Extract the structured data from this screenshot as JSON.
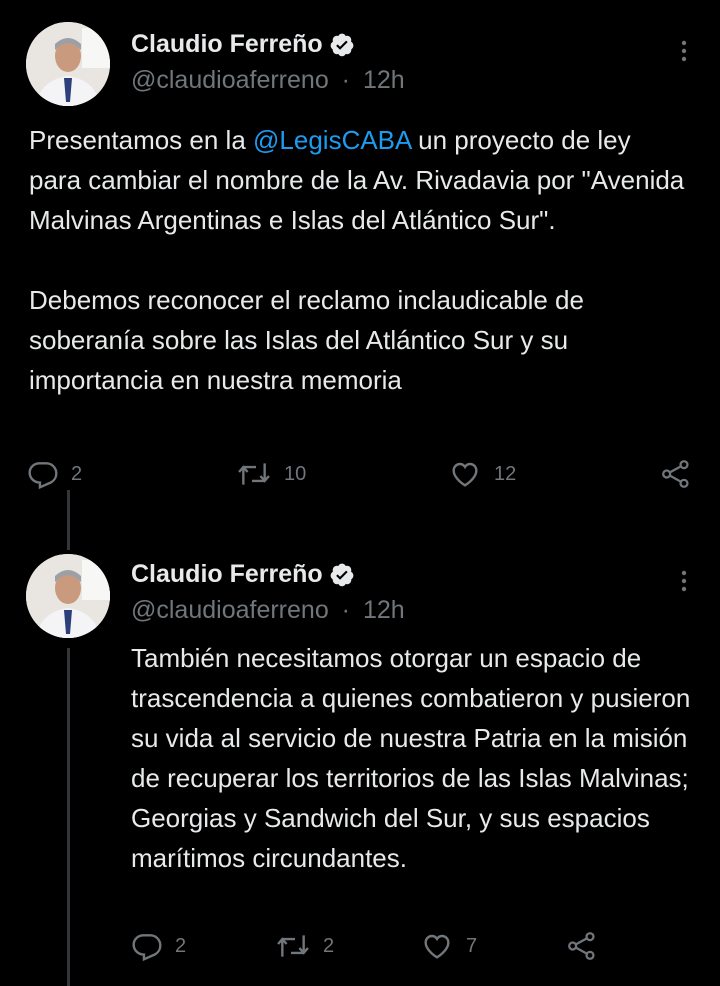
{
  "tweets": [
    {
      "author": {
        "name": "Claudio Ferreño",
        "handle": "@claudioaferreno",
        "time": "12h",
        "separator": "·"
      },
      "text_parts": {
        "p1_pre": "Presentamos en la ",
        "p1_mention": "@LegisCABA",
        "p1_post": " un proyecto de ley para cambiar el nombre de la Av. Rivadavia por \"Avenida Malvinas Argentinas e Islas del Atlántico Sur\".",
        "p2": "Debemos reconocer el reclamo inclaudicable de soberanía sobre las Islas del Atlántico Sur y su importancia en nuestra memoria"
      },
      "stats": {
        "replies": "2",
        "retweets": "10",
        "likes": "12"
      }
    },
    {
      "author": {
        "name": "Claudio Ferreño",
        "handle": "@claudioaferreno",
        "time": "12h",
        "separator": "·"
      },
      "text": "También necesitamos otorgar un espacio de trascendencia a quienes combatieron y pusieron su vida al servicio de nuestra Patria en la misión de recuperar los territorios de las Islas Malvinas; Georgias y Sandwich del Sur, y sus espacios marítimos circundantes.",
      "stats": {
        "replies": "2",
        "retweets": "2",
        "likes": "7"
      }
    }
  ],
  "colors": {
    "background": "#000000",
    "text": "#e7e9ea",
    "secondary": "#71767b",
    "link": "#1d9bf0",
    "thread_line": "#333639"
  },
  "icons": [
    "verified-badge-icon",
    "more-options-icon",
    "reply-icon",
    "retweet-icon",
    "like-icon",
    "share-icon"
  ]
}
